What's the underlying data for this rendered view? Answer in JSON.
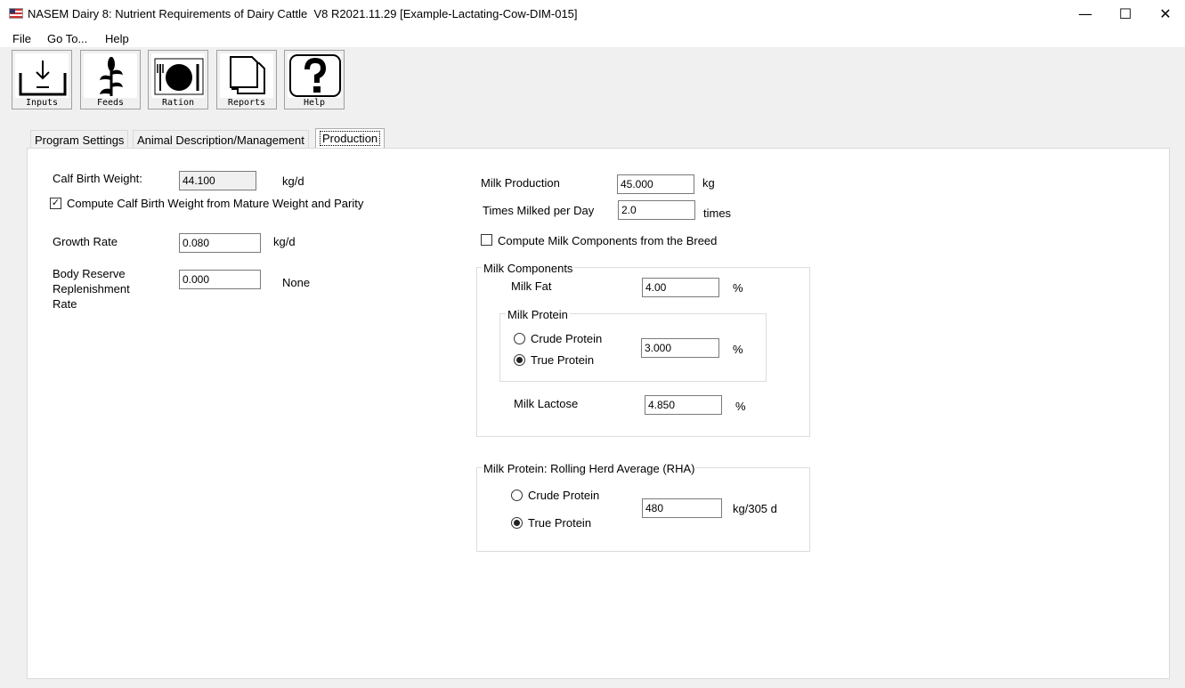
{
  "window": {
    "title": "NASEM Dairy 8: Nutrient Requirements of Dairy Cattle  V8 R2021.11.29 [Example-Lactating-Cow-DIM-015]",
    "minimize_glyph": "—",
    "maximize_glyph": "☐",
    "close_glyph": "✕"
  },
  "menu": {
    "file": "File",
    "goto": "Go To...",
    "help": "Help"
  },
  "toolbar": {
    "inputs": "Inputs",
    "feeds": "Feeds",
    "ration": "Ration",
    "reports": "Reports",
    "help": "Help"
  },
  "tabs": {
    "program_settings": "Program Settings",
    "animal_description": "Animal Description/Management",
    "production": "Production"
  },
  "left": {
    "calf_birth_weight_label": "Calf Birth Weight:",
    "calf_birth_weight_value": "44.100",
    "calf_birth_weight_unit": "kg/d",
    "compute_calf_label": "Compute Calf Birth Weight from Mature Weight and Parity",
    "compute_calf_checked": "✓",
    "growth_rate_label": "Growth Rate",
    "growth_rate_value": "0.080",
    "growth_rate_unit": "kg/d",
    "body_reserve_label_1": "Body Reserve",
    "body_reserve_label_2": "Replenishment",
    "body_reserve_label_3": "Rate",
    "body_reserve_value": "0.000",
    "body_reserve_unit": "None"
  },
  "right": {
    "milk_production_label": "Milk Production",
    "milk_production_value": "45.000",
    "milk_production_unit": "kg",
    "times_milked_label": "Times Milked per Day",
    "times_milked_value": "2.0",
    "times_milked_unit": "times",
    "compute_components_label": "Compute Milk Components from the Breed"
  },
  "milk_components": {
    "title": "Milk Components",
    "fat_label": "Milk Fat",
    "fat_value": "4.00",
    "fat_unit": "%",
    "protein_group_title": "Milk Protein",
    "crude_protein": "Crude Protein",
    "true_protein": "True Protein",
    "protein_value": "3.000",
    "protein_unit": "%",
    "lactose_label": "Milk Lactose",
    "lactose_value": "4.850",
    "lactose_unit": "%"
  },
  "rha": {
    "title": "Milk Protein: Rolling Herd Average (RHA)",
    "crude_protein": "Crude Protein",
    "true_protein": "True Protein",
    "value": "480",
    "unit": "kg/305 d"
  }
}
